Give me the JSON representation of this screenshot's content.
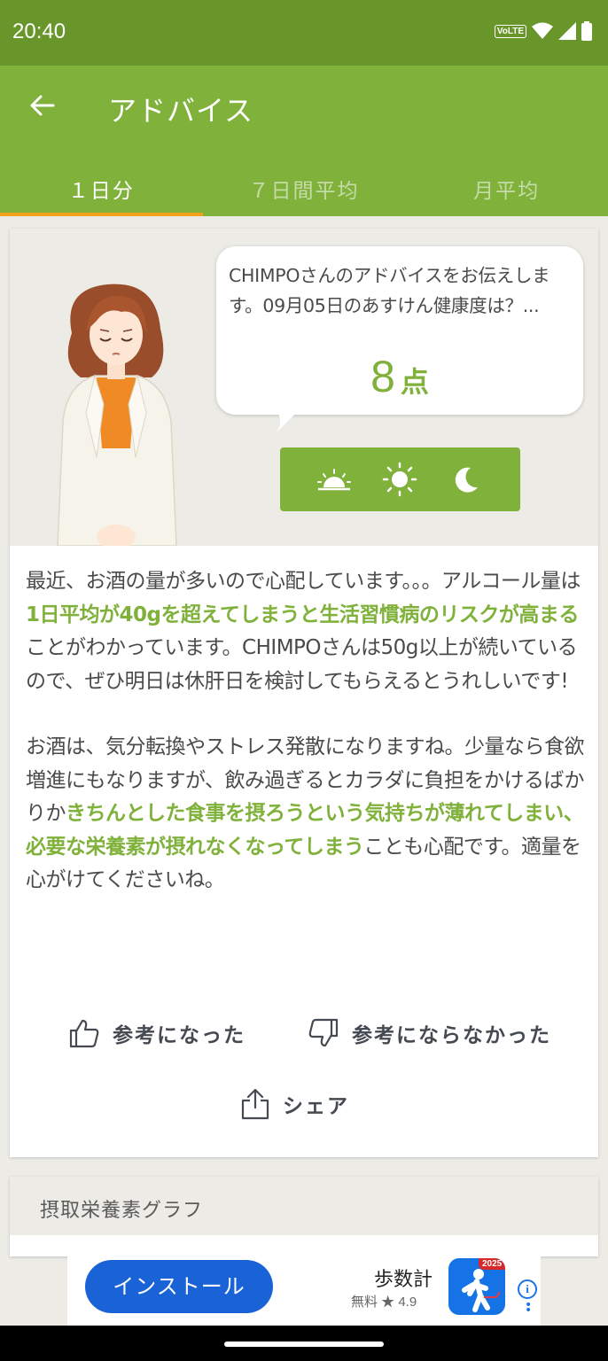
{
  "status": {
    "time": "20:40",
    "volte": "VoLTE"
  },
  "appbar": {
    "title": "アドバイス",
    "tabs": [
      {
        "label": "１日分",
        "active": true
      },
      {
        "label": "７日間平均",
        "active": false
      },
      {
        "label": "月平均",
        "active": false
      }
    ]
  },
  "advice": {
    "bubble_text": "CHIMPOさんのアドバイスをお伝えします。09月05日のあすけん健康度は？...",
    "score": "8",
    "score_unit": "点",
    "time_buttons": [
      "sunrise-icon",
      "sun-icon",
      "moon-icon"
    ],
    "para1": [
      {
        "t": "最近、お酒の量が多いので心配しています。。。アルコール量は",
        "hl": false
      },
      {
        "t": "1日平均が40gを超えてしまうと生活習慣病のリスクが高まる",
        "hl": true
      },
      {
        "t": "ことがわかっています。CHIMPOさんは50g以上が続いているので、ぜひ明日は休肝日を検討してもらえるとうれしいです!",
        "hl": false
      }
    ],
    "para2": [
      {
        "t": "お酒は、気分転換やストレス発散になりますね。少量なら食欲増進にもなりますが、飲み過ぎるとカラダに負担をかけるばかりか",
        "hl": false
      },
      {
        "t": "きちんとした食事を摂ろうという気持ちが薄れてしまい、必要な栄養素が摂れなくなってしまう",
        "hl": true
      },
      {
        "t": "ことも心配です。適量を心がけてくださいね。",
        "hl": false
      }
    ],
    "helpful_label": "参考になった",
    "not_helpful_label": "参考にならなかった",
    "share_label": "シェア"
  },
  "graph": {
    "title": "摂取栄養素グラフ"
  },
  "ad": {
    "install_label": "インストール",
    "app_name": "歩数計",
    "meta": "無料 ★ 4.9",
    "badge": "2025",
    "info": "i"
  },
  "colors": {
    "primary": "#7fb13b",
    "status": "#69962a",
    "accent": "#f2a21a",
    "ad_blue": "#1a63d6"
  }
}
